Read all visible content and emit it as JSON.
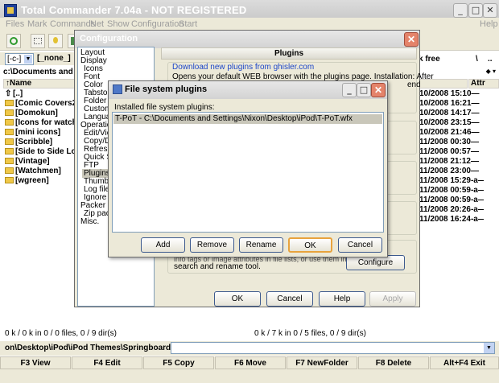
{
  "window": {
    "title": "Total Commander 7.04a - NOT REGISTERED",
    "help": "Help"
  },
  "menu": [
    "Files",
    "Mark",
    "Commands",
    "Net",
    "Show",
    "Configuration",
    "Start"
  ],
  "left_panel": {
    "drive": "[-c-]",
    "volume": "[_none_]",
    "path": "c:\\Documents and",
    "col_name": "↑Name",
    "items": [
      "[..]",
      "[Comic Covers2]",
      "[Domokun]",
      "[Icons for watch",
      "[mini icons]",
      "[Scribble]",
      "[Side to Side Lo",
      "[Vintage]",
      "[Watchmen]",
      "[wgreen]"
    ],
    "status": "0 k / 0 k in 0 / 0 files, 0 / 9 dir(s)"
  },
  "right_panel": {
    "free": "k free",
    "sep": "\\",
    "dotdot": "..",
    "col_attr": "Attr",
    "rows": [
      "10/2008 15:10—",
      "10/2008 16:21—",
      "10/2008 14:17—",
      "10/2008 23:15—",
      "10/2008 21:46—",
      "11/2008 00:30—",
      "11/2008 00:57—",
      "11/2008 21:12—",
      "11/2008 23:00—",
      "11/2008 15:29-a—",
      "11/2008 00:59-a—",
      "11/2008 00:59-a—",
      "11/2008 20:26-a—",
      "11/2008 16:24-a—"
    ],
    "status": "0 k / 7 k in 0 / 5 files, 0 / 9 dir(s)"
  },
  "command_path": "on\\Desktop\\iPod\\iPod Themes\\Springboard>",
  "fkeys": [
    "F3 View",
    "F4 Edit",
    "F5 Copy",
    "F6 Move",
    "F7 NewFolder",
    "F8 Delete",
    "Alt+F4 Exit"
  ],
  "config": {
    "title": "Configuration",
    "tree": [
      "Layout",
      "Display",
      "Icons",
      "Font",
      "Color",
      "Tabstop",
      "Folder T",
      "Custom",
      "Languag",
      "Operation",
      "Edit/Vie",
      "Copy/De",
      "Refresh",
      "Quick S",
      "FTP",
      "Plugins",
      "Thumbn",
      "Log file",
      "Ignore li",
      "Packer",
      "Zip pack",
      "Misc."
    ],
    "section": "Plugins",
    "link": "Download new plugins from ghisler.com",
    "desc": "Opens your default WEB browser with the plugins page. Installation: After",
    "desc_end": "end",
    "lower_text1": "info tags or image attributes in file lists, or use them in",
    "lower_text2": "search and rename tool.",
    "configure": "Configure",
    "ok": "OK",
    "cancel": "Cancel",
    "help": "Help",
    "apply": "Apply"
  },
  "fs_plugins": {
    "title": "File system plugins",
    "label": "Installed file system plugins:",
    "items": [
      "T-PoT  -  C:\\Documents and Settings\\Nixon\\Desktop\\iPod\\T-PoT.wfx"
    ],
    "add": "Add",
    "remove": "Remove",
    "rename": "Rename",
    "ok": "OK",
    "cancel": "Cancel"
  },
  "colors": {
    "accent": "#316ac5",
    "link": "#1c46c8",
    "selected_row": "#c9c7ba"
  }
}
